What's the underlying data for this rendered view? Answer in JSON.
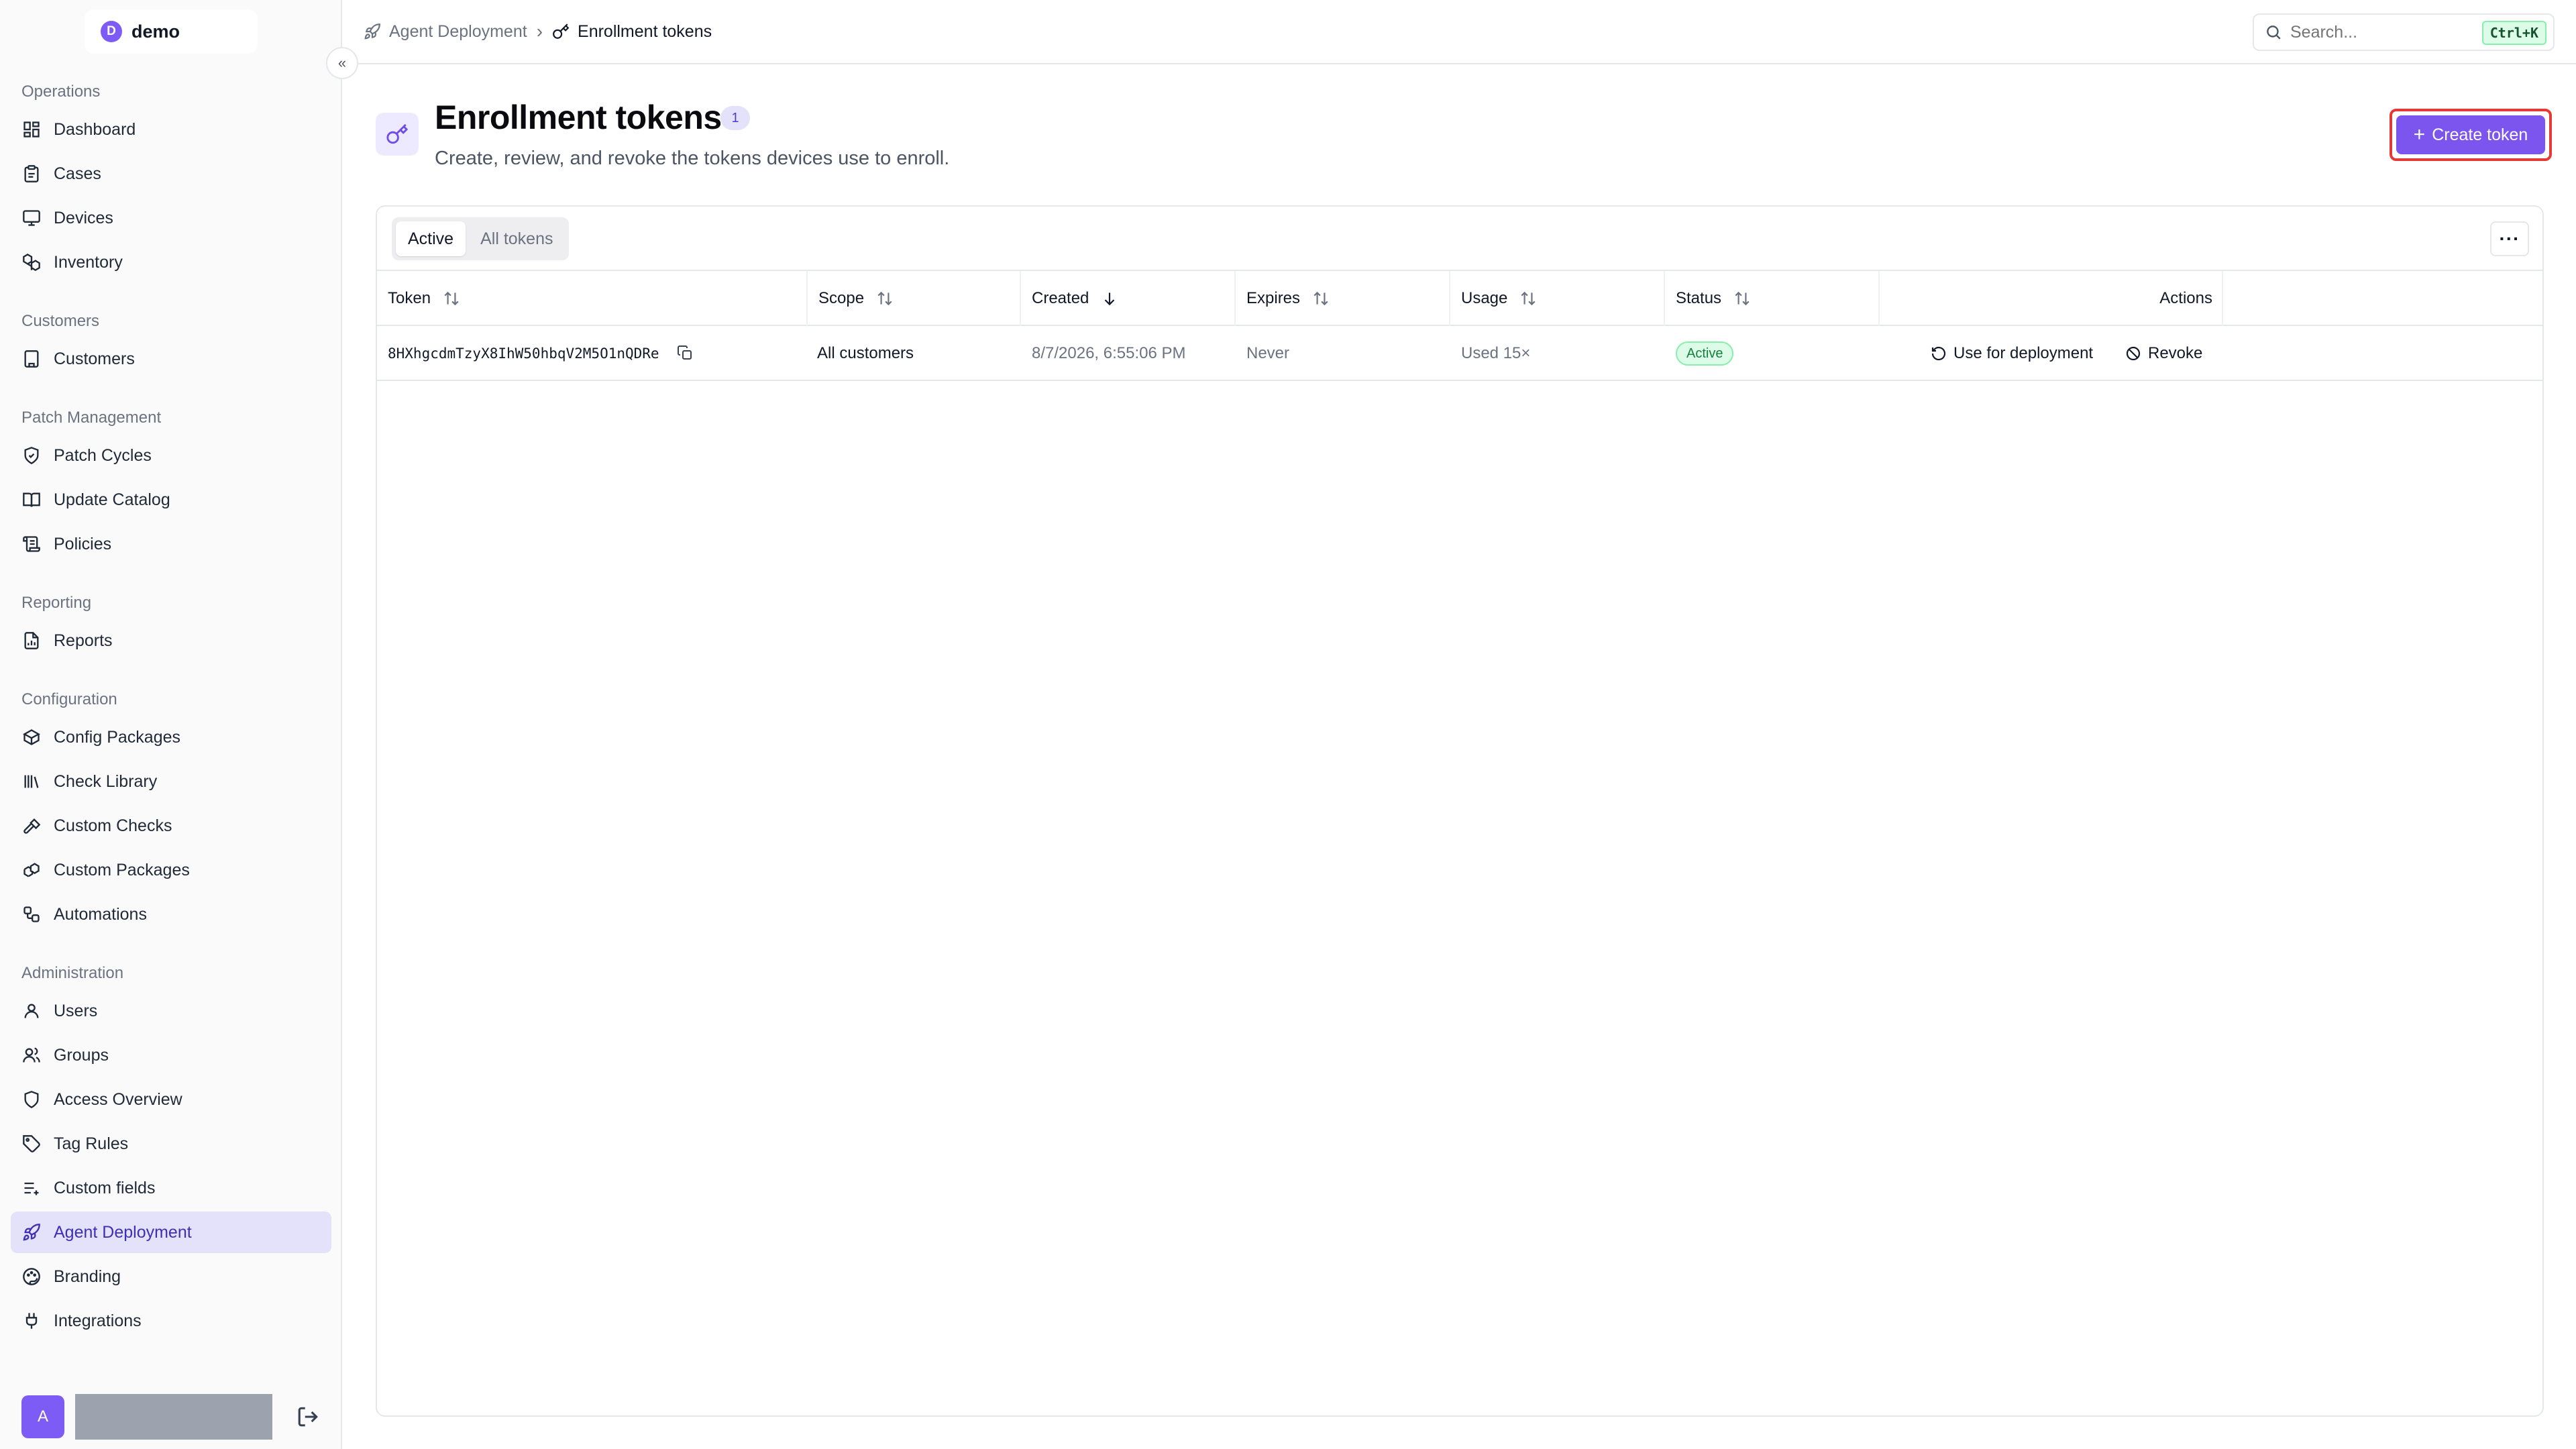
{
  "app": {
    "workspace_initial": "D",
    "workspace_name": "demo"
  },
  "sidebar": {
    "groups": [
      {
        "label": "Operations",
        "items": [
          {
            "label": "Dashboard",
            "icon": "dashboard-icon"
          },
          {
            "label": "Cases",
            "icon": "clipboard-icon"
          },
          {
            "label": "Devices",
            "icon": "monitor-icon"
          },
          {
            "label": "Inventory",
            "icon": "boxes-icon"
          }
        ]
      },
      {
        "label": "Customers",
        "items": [
          {
            "label": "Customers",
            "icon": "building-icon"
          }
        ]
      },
      {
        "label": "Patch Management",
        "items": [
          {
            "label": "Patch Cycles",
            "icon": "shield-check-icon"
          },
          {
            "label": "Update Catalog",
            "icon": "book-icon"
          },
          {
            "label": "Policies",
            "icon": "scroll-icon"
          }
        ]
      },
      {
        "label": "Reporting",
        "items": [
          {
            "label": "Reports",
            "icon": "report-icon"
          }
        ]
      },
      {
        "label": "Configuration",
        "items": [
          {
            "label": "Config Packages",
            "icon": "package-icon"
          },
          {
            "label": "Check Library",
            "icon": "library-icon"
          },
          {
            "label": "Custom Checks",
            "icon": "hammer-icon"
          },
          {
            "label": "Custom Packages",
            "icon": "packages-icon"
          },
          {
            "label": "Automations",
            "icon": "workflow-icon"
          }
        ]
      },
      {
        "label": "Administration",
        "items": [
          {
            "label": "Users",
            "icon": "user-icon"
          },
          {
            "label": "Groups",
            "icon": "users-icon"
          },
          {
            "label": "Access Overview",
            "icon": "shield-icon"
          },
          {
            "label": "Tag Rules",
            "icon": "tag-icon"
          },
          {
            "label": "Custom fields",
            "icon": "list-plus-icon"
          },
          {
            "label": "Agent Deployment",
            "icon": "rocket-icon",
            "active": true
          },
          {
            "label": "Branding",
            "icon": "palette-icon"
          },
          {
            "label": "Integrations",
            "icon": "plug-icon"
          }
        ]
      }
    ],
    "user_initial": "A"
  },
  "topbar": {
    "breadcrumb": [
      {
        "label": "Agent Deployment",
        "icon": "rocket-icon"
      },
      {
        "label": "Enrollment tokens",
        "icon": "key-icon"
      }
    ],
    "search_placeholder": "Search...",
    "search_shortcut": "Ctrl+K"
  },
  "page": {
    "title": "Enrollment tokens",
    "count": "1",
    "subtitle": "Create, review, and revoke the tokens devices use to enroll.",
    "create_button": "Create token"
  },
  "table": {
    "filters": [
      "Active",
      "All tokens"
    ],
    "active_filter": "Active",
    "columns": [
      "Token",
      "Scope",
      "Created",
      "Expires",
      "Usage",
      "Status",
      "Actions"
    ],
    "sorted_column": "Created",
    "rows": [
      {
        "token": "8HXhgcdmTzyX8IhW50hbqV2M5O1nQDRe",
        "scope": "All customers",
        "created": "8/7/2026, 6:55:06 PM",
        "expires": "Never",
        "usage": "Used 15×",
        "status": "Active",
        "action_deploy": "Use for deployment",
        "action_revoke": "Revoke"
      }
    ]
  },
  "colors": {
    "accent": "#7c55ef",
    "active_nav_bg": "#e4e1fb",
    "status_active": "#15803d",
    "highlight_outline": "#e53935"
  }
}
